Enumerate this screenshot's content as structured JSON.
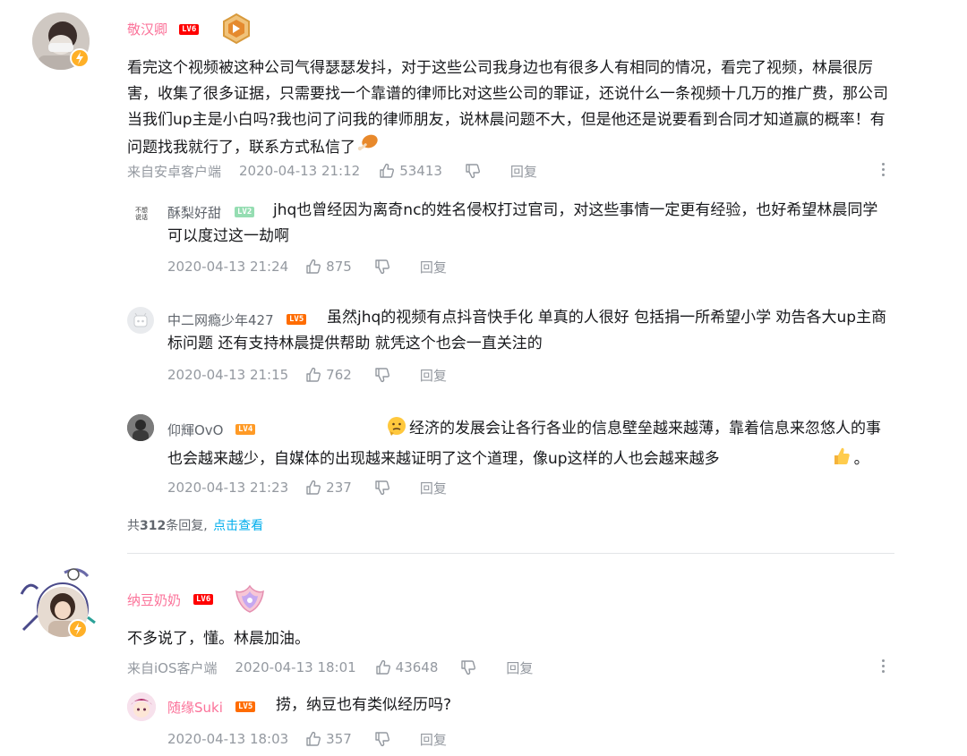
{
  "colors": {
    "pink": "#fb7299",
    "blue": "#00aeec",
    "grey": "#9499a0",
    "lv6": "#ff0000",
    "lv5": "#ff6c00",
    "lv4": "#ff9a25",
    "lv2": "#95ddb2"
  },
  "comment1": {
    "username": "敬汉卿",
    "level": "LV6",
    "text": "看完这个视频被这种公司气得瑟瑟发抖，对于这些公司我身边也有很多人有相同的情况，看完了视频，林晨很厉害，收集了很多证据，只需要找一个靠谱的律师比对这些公司的罪证，还说什么一条视频十几万的推广费，那公司当我们up主是小白吗?我也问了问我的律师朋友，说林晨问题不大，但是他还是说要看到合同才知道赢的概率！有问题找我就行了，联系方式私信了",
    "emoji": "drumstick-emoji",
    "source": "来自安卓客户端",
    "time": "2020-04-13 21:12",
    "likes": "53413",
    "reply_label": "回复",
    "replies": [
      {
        "username": "酥梨好甜",
        "level": "LV2",
        "avatar_text": "不想说话",
        "text": "jhq也曾经因为离奇nc的姓名侵权打过官司，对这些事情一定更有经验，也好希望林晨同学可以度过这一劫啊",
        "time": "2020-04-13 21:24",
        "likes": "875",
        "reply_label": "回复"
      },
      {
        "username": "中二网瘾少年427",
        "level": "LV5",
        "text": "虽然jhq的视频有点抖音快手化 单真的人很好 包括捐一所希望小学 劝告各大up主商标问题 还有支持林晨提供帮助 就凭这个也会一直关注的",
        "time": "2020-04-13 21:15",
        "likes": "762",
        "reply_label": "回复"
      },
      {
        "username": "仰輝OvO",
        "level": "LV4",
        "text": "经济的发展会让各行各业的信息壁垒越来越薄，靠着信息来忽悠人的事也会越来越少，自媒体的出现越来越证明了这个道理，像up这样的人也会越来越多",
        "text_end": "。",
        "time": "2020-04-13 21:23",
        "likes": "237",
        "reply_label": "回复"
      }
    ],
    "more_prefix": "共",
    "more_count": "312",
    "more_suffix": "条回复,",
    "more_link": "点击查看"
  },
  "comment2": {
    "username": "纳豆奶奶",
    "level": "LV6",
    "text": "不多说了，懂。林晨加油。",
    "source": "来自iOS客户端",
    "time": "2020-04-13 18:01",
    "likes": "43648",
    "reply_label": "回复",
    "replies": [
      {
        "username": "随缘Suki",
        "level": "LV5",
        "text": "捞，纳豆也有类似经历吗?",
        "time": "2020-04-13 18:03",
        "likes": "357",
        "reply_label": "回复"
      }
    ]
  }
}
